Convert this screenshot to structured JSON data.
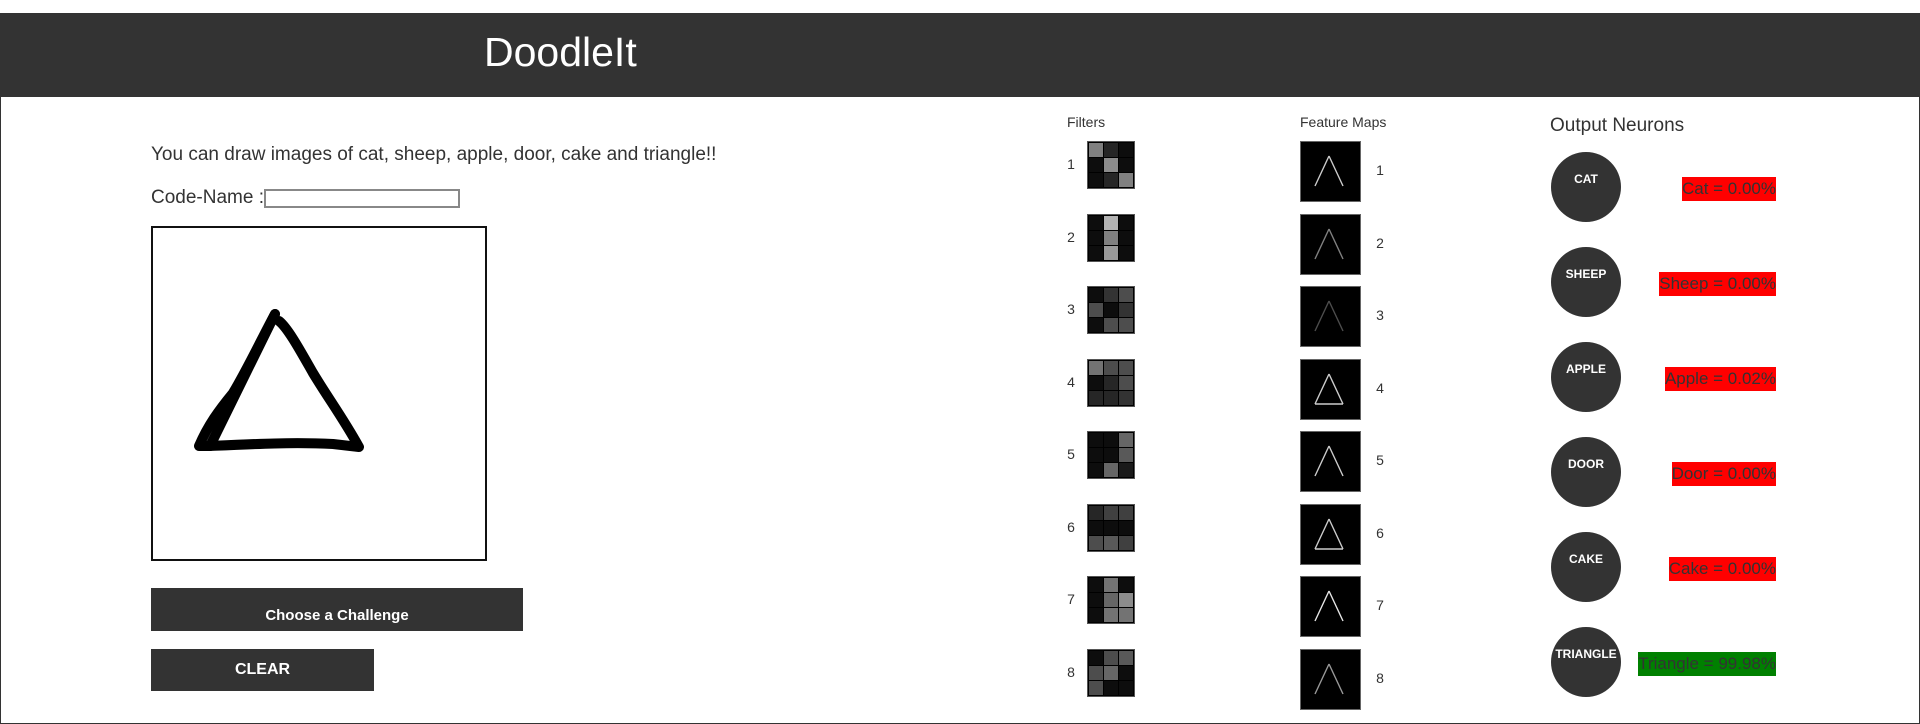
{
  "app": {
    "title": "DoodleIt"
  },
  "intro_text": "You can draw images of cat, sheep, apple, door, cake and triangle!!",
  "codename": {
    "label": "Code-Name :",
    "value": ""
  },
  "buttons": {
    "challenge": "Choose a Challenge",
    "clear": "CLEAR"
  },
  "filters": {
    "title": "Filters",
    "items": [
      {
        "label": "1",
        "cells": [
          [
            0.5,
            0.15,
            0.05
          ],
          [
            0.05,
            0.55,
            0.05
          ],
          [
            0.05,
            0.15,
            0.5
          ]
        ]
      },
      {
        "label": "2",
        "cells": [
          [
            0.05,
            0.7,
            0.05
          ],
          [
            0.05,
            0.5,
            0.05
          ],
          [
            0.05,
            0.6,
            0.05
          ]
        ]
      },
      {
        "label": "3",
        "cells": [
          [
            0.05,
            0.2,
            0.3
          ],
          [
            0.3,
            0.05,
            0.2
          ],
          [
            0.05,
            0.3,
            0.3
          ]
        ]
      },
      {
        "label": "4",
        "cells": [
          [
            0.45,
            0.3,
            0.3
          ],
          [
            0.05,
            0.15,
            0.3
          ],
          [
            0.15,
            0.15,
            0.2
          ]
        ]
      },
      {
        "label": "5",
        "cells": [
          [
            0.05,
            0.05,
            0.4
          ],
          [
            0.05,
            0.05,
            0.35
          ],
          [
            0.05,
            0.4,
            0.1
          ]
        ]
      },
      {
        "label": "6",
        "cells": [
          [
            0.15,
            0.25,
            0.25
          ],
          [
            0.05,
            0.05,
            0.05
          ],
          [
            0.3,
            0.35,
            0.25
          ]
        ]
      },
      {
        "label": "7",
        "cells": [
          [
            0.05,
            0.45,
            0.05
          ],
          [
            0.05,
            0.4,
            0.55
          ],
          [
            0.05,
            0.45,
            0.45
          ]
        ]
      },
      {
        "label": "8",
        "cells": [
          [
            0.05,
            0.3,
            0.35
          ],
          [
            0.3,
            0.4,
            0.05
          ],
          [
            0.3,
            0.05,
            0.05
          ]
        ]
      }
    ]
  },
  "feature_maps": {
    "title": "Feature Maps",
    "items": [
      {
        "label": "1",
        "brightness": 0.8
      },
      {
        "label": "2",
        "brightness": 0.5
      },
      {
        "label": "3",
        "brightness": 0.3
      },
      {
        "label": "4",
        "brightness": 0.8
      },
      {
        "label": "5",
        "brightness": 0.8
      },
      {
        "label": "6",
        "brightness": 0.8
      },
      {
        "label": "7",
        "brightness": 0.9
      },
      {
        "label": "8",
        "brightness": 0.6
      }
    ]
  },
  "output": {
    "title": "Output Neurons",
    "neurons": [
      {
        "name": "CAT",
        "text": "Cat = 0.00%",
        "color": "#ff0000"
      },
      {
        "name": "SHEEP",
        "text": "Sheep = 0.00%",
        "color": "#ff0000"
      },
      {
        "name": "APPLE",
        "text": "Apple = 0.02%",
        "color": "#ff0000"
      },
      {
        "name": "DOOR",
        "text": "Door = 0.00%",
        "color": "#ff0000"
      },
      {
        "name": "CAKE",
        "text": "Cake = 0.00%",
        "color": "#ff0000"
      },
      {
        "name": "TRIANGLE",
        "text": "Triangle = 99.98%",
        "color": "#008000"
      }
    ]
  },
  "colors": {
    "header": "#333333",
    "negative": "#ff0000",
    "positive": "#008000"
  }
}
